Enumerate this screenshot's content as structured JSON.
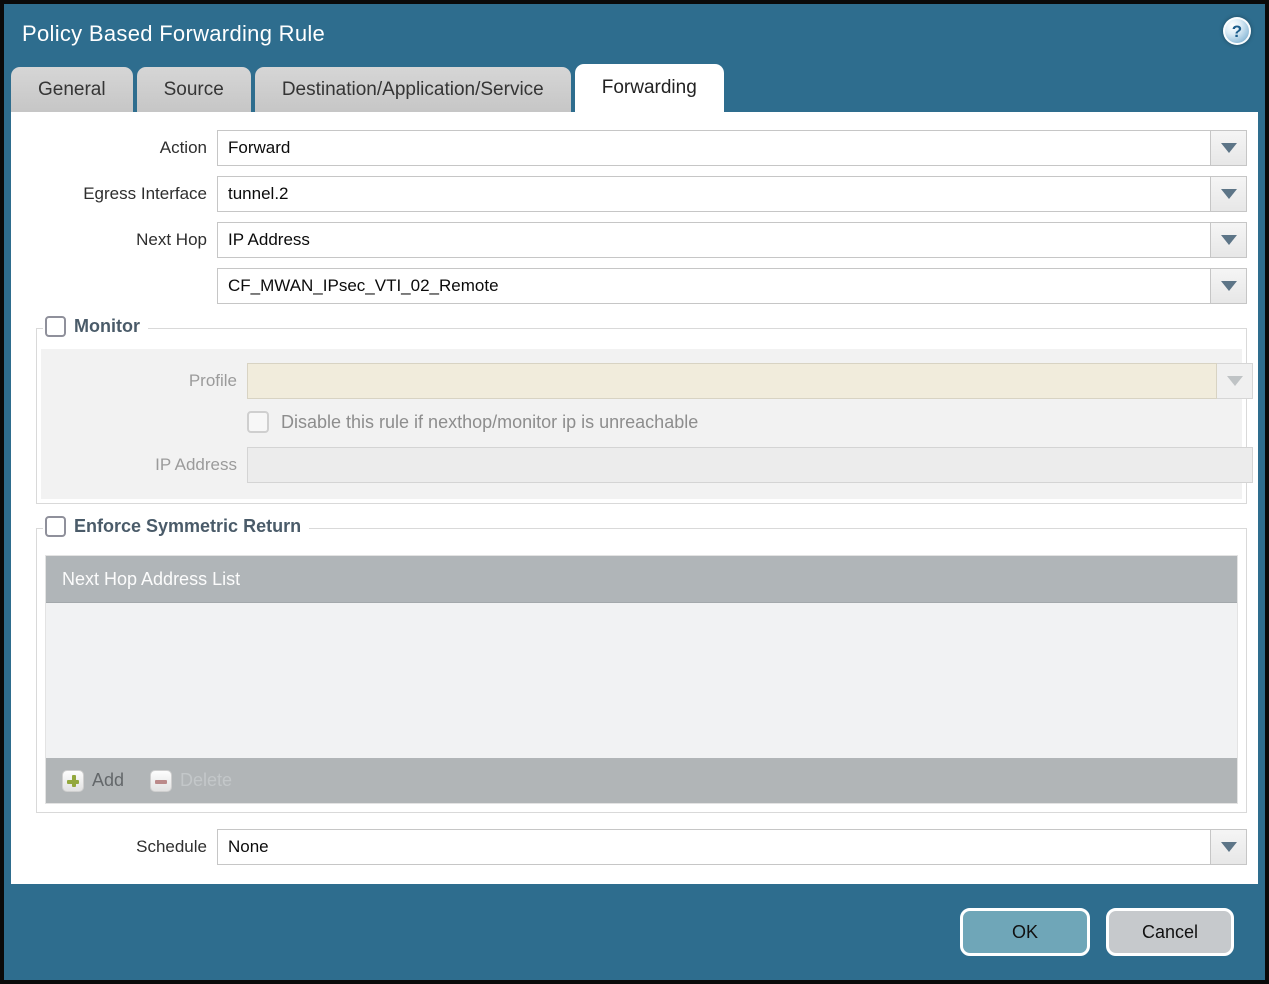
{
  "window": {
    "title": "Policy Based Forwarding Rule"
  },
  "tabs": [
    {
      "label": "General",
      "active": false
    },
    {
      "label": "Source",
      "active": false
    },
    {
      "label": "Destination/Application/Service",
      "active": false
    },
    {
      "label": "Forwarding",
      "active": true
    }
  ],
  "form": {
    "action": {
      "label": "Action",
      "value": "Forward"
    },
    "egress_interface": {
      "label": "Egress Interface",
      "value": "tunnel.2"
    },
    "next_hop": {
      "label": "Next Hop",
      "value": "IP Address"
    },
    "next_hop_address": {
      "value": "CF_MWAN_IPsec_VTI_02_Remote"
    },
    "schedule": {
      "label": "Schedule",
      "value": "None"
    }
  },
  "monitor": {
    "legend": "Monitor",
    "checked": false,
    "profile": {
      "label": "Profile",
      "value": ""
    },
    "disable_rule": {
      "label": "Disable this rule if nexthop/monitor ip is unreachable",
      "checked": false
    },
    "ip_address": {
      "label": "IP Address",
      "value": ""
    }
  },
  "symmetric_return": {
    "legend": "Enforce Symmetric Return",
    "checked": false,
    "table": {
      "header": "Next Hop Address List",
      "rows": []
    },
    "add_label": "Add",
    "delete_label": "Delete"
  },
  "footer": {
    "ok_label": "OK",
    "cancel_label": "Cancel"
  },
  "colors": {
    "accent_teal": "#2e6d8e",
    "ok_button": "#6fa6b8",
    "cancel_button": "#c6c9cc",
    "disabled_field_beige": "#f1ecdc",
    "table_header_gray": "#b0b5b8"
  }
}
